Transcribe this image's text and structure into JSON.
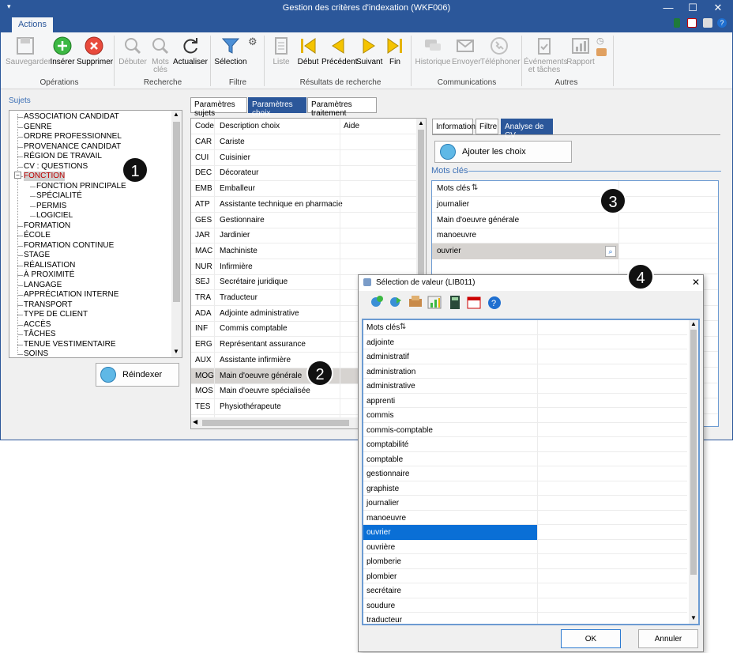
{
  "window": {
    "title": "Gestion des critères d'indexation (WKF006)",
    "controls": {
      "minimize": "—",
      "maximize": "☐",
      "close": "✕"
    }
  },
  "ribbon": {
    "tab": "Actions",
    "groups": {
      "operations": {
        "label": "Opérations",
        "buttons": {
          "save": "Sauvegarder",
          "insert": "Insérer",
          "delete": "Supprimer"
        }
      },
      "recherche": {
        "label": "Recherche",
        "buttons": {
          "start": "Débuter",
          "keywords_l1": "Mots",
          "keywords_l2": "clés",
          "refresh": "Actualiser"
        }
      },
      "filtre": {
        "label": "Filtre",
        "buttons": {
          "selection": "Sélection"
        }
      },
      "resultats": {
        "label": "Résultats de recherche",
        "buttons": {
          "list": "Liste",
          "first": "Début",
          "prev": "Précédent",
          "next": "Suivant",
          "last": "Fin"
        }
      },
      "communications": {
        "label": "Communications",
        "buttons": {
          "history": "Historique",
          "send": "Envoyer",
          "phone": "Téléphoner"
        }
      },
      "autres": {
        "label": "Autres",
        "buttons": {
          "events_l1": "Événements",
          "events_l2": "et tâches",
          "report": "Rapport"
        }
      }
    }
  },
  "left": {
    "label": "Sujets",
    "tree": [
      {
        "label": "ASSOCIATION CANDIDAT",
        "level": 0
      },
      {
        "label": "GENRE",
        "level": 0
      },
      {
        "label": "ORDRE PROFESSIONNEL",
        "level": 0
      },
      {
        "label": "PROVENANCE CANDIDAT",
        "level": 0
      },
      {
        "label": "RÉGION DE TRAVAIL",
        "level": 0
      },
      {
        "label": "CV : QUESTIONS",
        "level": 0
      },
      {
        "label": "FONCTION",
        "level": 0
      },
      {
        "label": "FONCTION PRINCIPALE",
        "level": 1
      },
      {
        "label": "SPÉCIALITÉ",
        "level": 1
      },
      {
        "label": "PERMIS",
        "level": 1
      },
      {
        "label": "LOGICIEL",
        "level": 1
      },
      {
        "label": "FORMATION",
        "level": 0
      },
      {
        "label": "ÉCOLE",
        "level": 0
      },
      {
        "label": "FORMATION CONTINUE",
        "level": 0
      },
      {
        "label": "STAGE",
        "level": 0
      },
      {
        "label": "RÉALISATION",
        "level": 0
      },
      {
        "label": "À PROXIMITÉ",
        "level": 0
      },
      {
        "label": "LANGAGE",
        "level": 0
      },
      {
        "label": "APPRÉCIATION INTERNE",
        "level": 0
      },
      {
        "label": "TRANSPORT",
        "level": 0
      },
      {
        "label": "TYPE DE CLIENT",
        "level": 0
      },
      {
        "label": "ACCÈS",
        "level": 0
      },
      {
        "label": "TÂCHES",
        "level": 0
      },
      {
        "label": "TENUE VESTIMENTAIRE",
        "level": 0
      },
      {
        "label": "SOINS",
        "level": 0
      }
    ],
    "selected": "FONCTION",
    "reindex": "Réindexer"
  },
  "middle": {
    "tabs": [
      "Paramètres sujets",
      "Paramètres choix",
      "Paramètres traitement"
    ],
    "active_tab": "Paramètres choix",
    "columns": [
      "Code",
      "Description choix",
      "Aide"
    ],
    "rows": [
      [
        "CAR",
        "Cariste"
      ],
      [
        "CUI",
        "Cuisinier"
      ],
      [
        "DEC",
        "Décorateur"
      ],
      [
        "EMB",
        "Emballeur"
      ],
      [
        "ATP",
        "Assistante technique en pharmacie"
      ],
      [
        "GES",
        "Gestionnaire"
      ],
      [
        "JAR",
        "Jardinier"
      ],
      [
        "MAC",
        "Machiniste"
      ],
      [
        "NUR",
        "Infirmière"
      ],
      [
        "SEJ",
        "Secrétaire juridique"
      ],
      [
        "TRA",
        "Traducteur"
      ],
      [
        "ADA",
        "Adjointe administrative"
      ],
      [
        "INF",
        "Commis comptable"
      ],
      [
        "ERG",
        "Représentant assurance"
      ],
      [
        "AUX",
        "Assistante infirmière"
      ],
      [
        "MOG",
        "Main d'oeuvre générale"
      ],
      [
        "MOS",
        "Main d'oeuvre spécialisée"
      ],
      [
        "TES",
        "Physiothérapeute"
      ]
    ],
    "selected_code": "MOG"
  },
  "right": {
    "tabs": [
      "Informations",
      "Filtre",
      "Analyse de CV"
    ],
    "active_tab": "Analyse de CV",
    "add_button": "Ajouter les choix",
    "section_label": "Mots clés",
    "header": "Mots clés",
    "rows": [
      "journalier",
      "Main d'oeuvre générale",
      "manoeuvre",
      "ouvrier"
    ],
    "selected": "ouvrier"
  },
  "dialog": {
    "title": "Sélection de valeur (LIB011)",
    "header": "Mots clés",
    "items": [
      "adjointe",
      "administratif",
      "administration",
      "administrative",
      "apprenti",
      "commis",
      "commis-comptable",
      "comptabilité",
      "comptable",
      "gestionnaire",
      "graphiste",
      "journalier",
      "manoeuvre",
      "ouvrier",
      "ouvrière",
      "plomberie",
      "plombier",
      "secrétaire",
      "soudure",
      "traducteur"
    ],
    "selected": "ouvrier",
    "ok": "OK",
    "cancel": "Annuler",
    "close": "✕"
  },
  "callouts": [
    "1",
    "2",
    "3",
    "4"
  ],
  "colors": {
    "accent": "#2b579a",
    "selection_blue": "#0a6fd6",
    "selection_gray": "#d6d3d0",
    "group_label": "#3b6fb5"
  }
}
